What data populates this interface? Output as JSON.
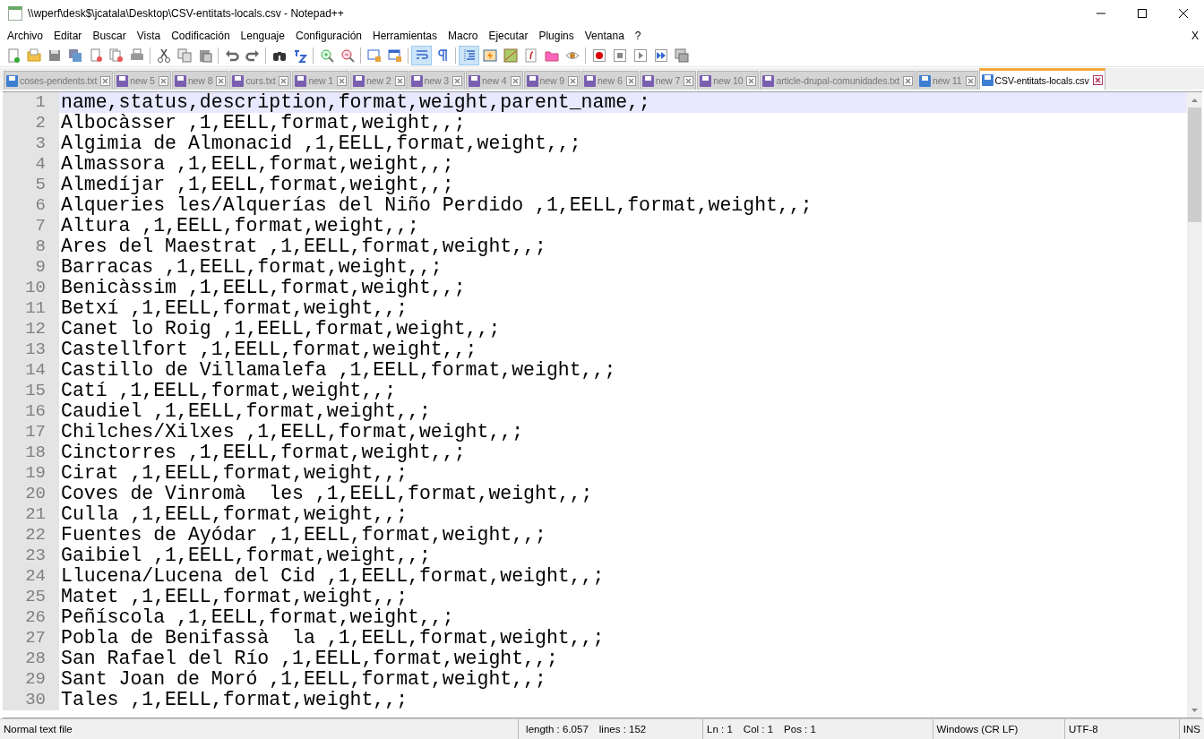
{
  "window": {
    "title": "\\\\wperf\\desk$\\jcatala\\Desktop\\CSV-entitats-locals.csv - Notepad++"
  },
  "menu": [
    "Archivo",
    "Editar",
    "Buscar",
    "Vista",
    "Codificación",
    "Lenguaje",
    "Configuración",
    "Herramientas",
    "Macro",
    "Ejecutar",
    "Plugins",
    "Ventana",
    "?"
  ],
  "menu_close": "X",
  "toolbar": [
    {
      "pressed": false
    },
    {
      "pressed": false
    },
    {
      "pressed": false
    },
    {
      "pressed": false
    },
    {
      "pressed": false
    },
    {
      "pressed": false
    },
    {
      "pressed": false
    },
    {
      "pressed": false
    },
    {
      "pressed": false
    },
    {
      "pressed": false
    },
    {
      "pressed": false
    },
    {
      "pressed": false
    },
    {
      "pressed": false
    },
    {
      "pressed": false
    },
    {
      "pressed": false
    },
    {
      "pressed": false
    },
    {
      "pressed": false
    },
    {
      "pressed": false
    },
    {
      "pressed": true
    },
    {
      "pressed": false
    },
    {
      "pressed": true
    },
    {
      "pressed": false
    },
    {
      "pressed": false
    },
    {
      "pressed": false
    },
    {
      "pressed": false
    },
    {
      "pressed": false
    },
    {
      "pressed": false
    },
    {
      "pressed": false
    },
    {
      "pressed": false
    },
    {
      "pressed": false
    },
    {
      "pressed": false
    }
  ],
  "tabs": [
    {
      "label": "coses-pendents.txt",
      "selected": false,
      "color": "#3c7fd0"
    },
    {
      "label": "new 5",
      "selected": false,
      "color": "#7a5fb0"
    },
    {
      "label": "new 8",
      "selected": false,
      "color": "#7a5fb0"
    },
    {
      "label": "curs.txt",
      "selected": false,
      "color": "#7a5fb0"
    },
    {
      "label": "new 1",
      "selected": false,
      "color": "#7a5fb0"
    },
    {
      "label": "new 2",
      "selected": false,
      "color": "#7a5fb0"
    },
    {
      "label": "new 3",
      "selected": false,
      "color": "#7a5fb0"
    },
    {
      "label": "new 4",
      "selected": false,
      "color": "#7a5fb0"
    },
    {
      "label": "new 9",
      "selected": false,
      "color": "#7a5fb0"
    },
    {
      "label": "new 6",
      "selected": false,
      "color": "#7a5fb0"
    },
    {
      "label": "new 7",
      "selected": false,
      "color": "#7a5fb0"
    },
    {
      "label": "new 10",
      "selected": false,
      "color": "#7a5fb0"
    },
    {
      "label": "article-drupal-comunidades.txt",
      "selected": false,
      "color": "#7a5fb0"
    },
    {
      "label": "new 11",
      "selected": false,
      "color": "#3c7fd0"
    },
    {
      "label": "CSV-entitats-locals.csv",
      "selected": true,
      "color": "#3c7fd0"
    }
  ],
  "editor": {
    "lines": [
      {
        "number": "1",
        "text": "name,status,description,format,weight,parent_name,;",
        "current": true
      },
      {
        "number": "2",
        "text": "Albocàsser ,1,EELL,format,weight,,;",
        "current": false
      },
      {
        "number": "3",
        "text": "Algimia de Almonacid ,1,EELL,format,weight,,;",
        "current": false
      },
      {
        "number": "4",
        "text": "Almassora ,1,EELL,format,weight,,;",
        "current": false
      },
      {
        "number": "5",
        "text": "Almedíjar ,1,EELL,format,weight,,;",
        "current": false
      },
      {
        "number": "6",
        "text": "Alqueries les/Alquerías del Niño Perdido ,1,EELL,format,weight,,;",
        "current": false
      },
      {
        "number": "7",
        "text": "Altura ,1,EELL,format,weight,,;",
        "current": false
      },
      {
        "number": "8",
        "text": "Ares del Maestrat ,1,EELL,format,weight,,;",
        "current": false
      },
      {
        "number": "9",
        "text": "Barracas ,1,EELL,format,weight,,;",
        "current": false
      },
      {
        "number": "10",
        "text": "Benicàssim ,1,EELL,format,weight,,;",
        "current": false
      },
      {
        "number": "11",
        "text": "Betxí ,1,EELL,format,weight,,;",
        "current": false
      },
      {
        "number": "12",
        "text": "Canet lo Roig ,1,EELL,format,weight,,;",
        "current": false
      },
      {
        "number": "13",
        "text": "Castellfort ,1,EELL,format,weight,,;",
        "current": false
      },
      {
        "number": "14",
        "text": "Castillo de Villamalefa ,1,EELL,format,weight,,;",
        "current": false
      },
      {
        "number": "15",
        "text": "Catí ,1,EELL,format,weight,,;",
        "current": false
      },
      {
        "number": "16",
        "text": "Caudiel ,1,EELL,format,weight,,;",
        "current": false
      },
      {
        "number": "17",
        "text": "Chilches/Xilxes ,1,EELL,format,weight,,;",
        "current": false
      },
      {
        "number": "18",
        "text": "Cinctorres ,1,EELL,format,weight,,;",
        "current": false
      },
      {
        "number": "19",
        "text": "Cirat ,1,EELL,format,weight,,;",
        "current": false
      },
      {
        "number": "20",
        "text": "Coves de Vinromà  les ,1,EELL,format,weight,,;",
        "current": false
      },
      {
        "number": "21",
        "text": "Culla ,1,EELL,format,weight,,;",
        "current": false
      },
      {
        "number": "22",
        "text": "Fuentes de Ayódar ,1,EELL,format,weight,,;",
        "current": false
      },
      {
        "number": "23",
        "text": "Gaibiel ,1,EELL,format,weight,,;",
        "current": false
      },
      {
        "number": "24",
        "text": "Llucena/Lucena del Cid ,1,EELL,format,weight,,;",
        "current": false
      },
      {
        "number": "25",
        "text": "Matet ,1,EELL,format,weight,,;",
        "current": false
      },
      {
        "number": "26",
        "text": "Peñíscola ,1,EELL,format,weight,,;",
        "current": false
      },
      {
        "number": "27",
        "text": "Pobla de Benifassà  la ,1,EELL,format,weight,,;",
        "current": false
      },
      {
        "number": "28",
        "text": "San Rafael del Río ,1,EELL,format,weight,,;",
        "current": false
      },
      {
        "number": "29",
        "text": "Sant Joan de Moró ,1,EELL,format,weight,,;",
        "current": false
      },
      {
        "number": "30",
        "text": "Tales ,1,EELL,format,weight,,;",
        "current": false
      }
    ]
  },
  "status_bar": {
    "file_type": "Normal text file",
    "length": "length : 6.057",
    "lines": "lines : 152",
    "ln": "Ln : 1",
    "col": "Col : 1",
    "pos": "Pos : 1",
    "eol": "Windows (CR LF)",
    "encoding": "UTF-8",
    "mode": "INS"
  }
}
